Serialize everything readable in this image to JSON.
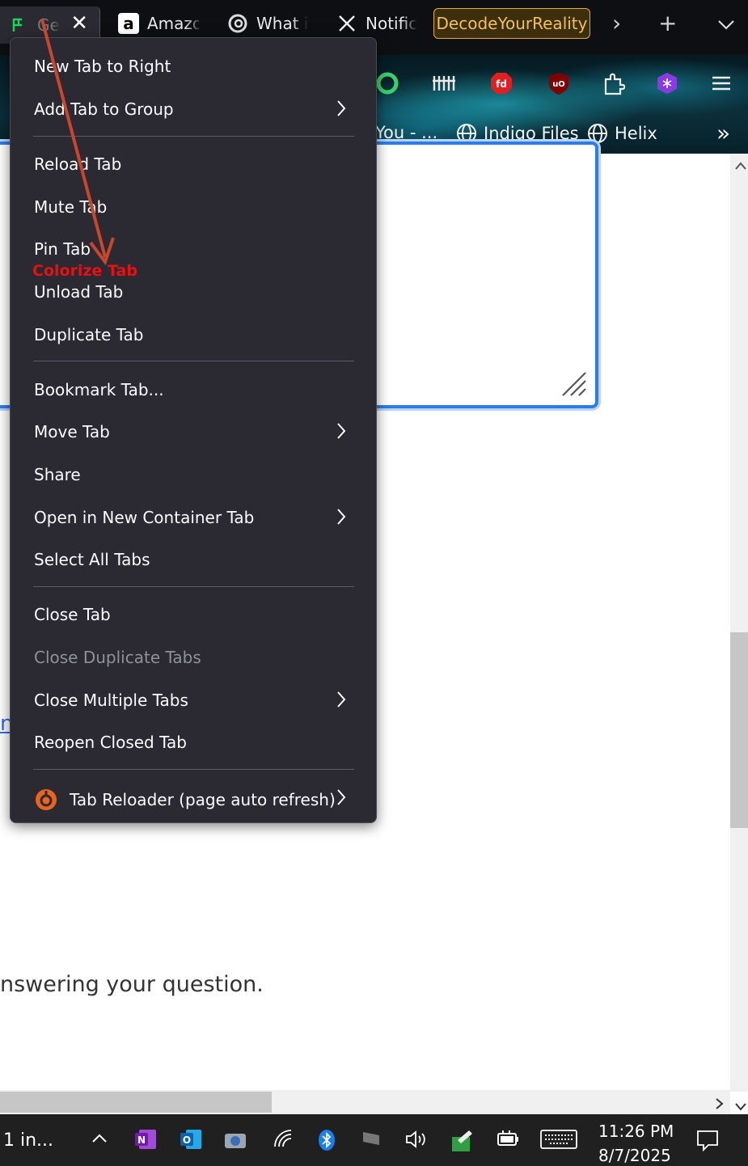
{
  "tabs": {
    "active": {
      "title": "Ge",
      "close": "✕"
    },
    "items": [
      {
        "label": "Amazo",
        "icon": "amazon-icon"
      },
      {
        "label": "What i",
        "icon": "threads-icon"
      },
      {
        "label": "Notific",
        "icon": "x-icon"
      }
    ],
    "highlight_tab": "DecodeYourReality",
    "more": "›",
    "new_tab": "+",
    "list_all": "⌄"
  },
  "bookmarks": [
    {
      "label": "You - ..."
    },
    {
      "label": "Indigo Files",
      "icon": "globe-icon"
    },
    {
      "label": "Helix",
      "icon": "globe-icon"
    }
  ],
  "bookmarks_overflow": "»",
  "toolbar_menu": "≡",
  "context_menu": {
    "items": [
      {
        "label": "New Tab to Right",
        "submenu": false
      },
      {
        "label": "Add Tab to Group",
        "submenu": true
      },
      {
        "label": "Reload Tab",
        "submenu": false
      },
      {
        "label": "Mute Tab",
        "submenu": false
      },
      {
        "label": "Pin Tab",
        "submenu": false
      },
      {
        "label": "Unload Tab",
        "submenu": false
      },
      {
        "label": "Duplicate Tab",
        "submenu": false
      },
      {
        "label": "Bookmark Tab...",
        "submenu": false
      },
      {
        "label": "Move Tab",
        "submenu": true
      },
      {
        "label": "Share",
        "submenu": false
      },
      {
        "label": "Open in New Container Tab",
        "submenu": true
      },
      {
        "label": "Select All Tabs",
        "submenu": false
      },
      {
        "label": "Close Tab",
        "submenu": false
      },
      {
        "label": "Close Duplicate Tabs",
        "submenu": false,
        "disabled": true
      },
      {
        "label": "Close Multiple Tabs",
        "submenu": true
      },
      {
        "label": "Reopen Closed Tab",
        "submenu": false
      },
      {
        "label": "Tab Reloader (page auto refresh)",
        "submenu": true,
        "icon": "tab-reloader-icon"
      }
    ],
    "annotation": "Colorize Tab"
  },
  "page": {
    "body_text": "nswering your question.",
    "link_fragment": "ne"
  },
  "taskbar": {
    "left_label": "1 in...",
    "show_hidden": "^",
    "time": "11:26 PM",
    "date": "8/7/2025"
  },
  "colors": {
    "menu_bg": "#2b2a33",
    "accent_blue": "#2b7ee8",
    "annotation_red": "#e81010",
    "arrow": "#c8452e",
    "highlight_tab_border": "#e6a93a"
  }
}
